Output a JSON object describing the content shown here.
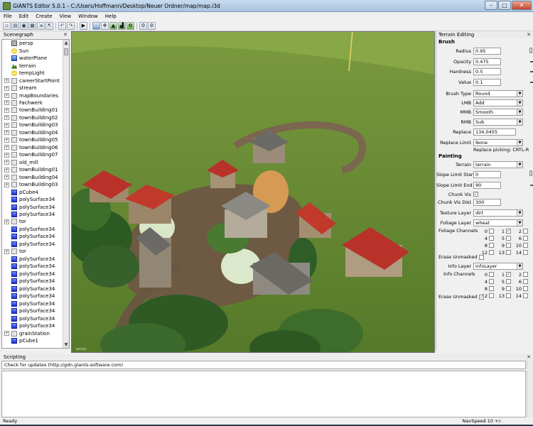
{
  "window": {
    "title": "GIANTS Editor 5.0.1 - C:/Users/Hoffmann/Desktop/Neuer Ordner/map/map.i3d",
    "minimize": "–",
    "maximize": "□",
    "close": "✕"
  },
  "menu": [
    "File",
    "Edit",
    "Create",
    "View",
    "Window",
    "Help"
  ],
  "toolbar": {
    "icons": [
      "new-icon",
      "open-icon",
      "save-icon",
      "save-as-icon",
      "import-icon",
      "export-icon",
      "sep",
      "undo-icon",
      "redo-icon",
      "sep",
      "play-icon",
      "sep",
      "select-tool-icon",
      "move-tool-icon",
      "terrain-sculpt-icon",
      "terrain-paint-icon",
      "foliage-paint-icon",
      "sep",
      "snap-icon",
      "grid-icon"
    ],
    "glyphs": [
      "▫",
      "▤",
      "▣",
      "▦",
      "⇲",
      "⇱",
      "",
      "↶",
      "↷",
      "",
      "▶",
      "",
      "⬚",
      "✥",
      "▲",
      "▟",
      "✿",
      "",
      "⚙",
      "⚙"
    ]
  },
  "scenegraph": {
    "title": "Scenegraph",
    "close": "✕",
    "nodes": [
      {
        "label": "persp",
        "icon": "camera-icon",
        "type": "cam",
        "expander": ""
      },
      {
        "label": "Sun",
        "icon": "light-icon",
        "type": "light",
        "expander": ""
      },
      {
        "label": "waterPlane",
        "icon": "water-icon",
        "type": "water",
        "expander": ""
      },
      {
        "label": "terrain",
        "icon": "terrain-icon",
        "type": "terr",
        "expander": ""
      },
      {
        "label": "tempLight",
        "icon": "light-icon",
        "type": "light",
        "expander": ""
      },
      {
        "label": "careerStartPoint",
        "icon": "transform-icon",
        "type": "folder",
        "expander": "+"
      },
      {
        "label": "stream",
        "icon": "transform-icon",
        "type": "folder",
        "expander": "+"
      },
      {
        "label": "mapBoundaries",
        "icon": "transform-icon",
        "type": "folder",
        "expander": "+"
      },
      {
        "label": "Fachwerk",
        "icon": "transform-icon",
        "type": "folder",
        "expander": "+"
      },
      {
        "label": "townBuilding01",
        "icon": "transform-icon",
        "type": "folder",
        "expander": "+"
      },
      {
        "label": "townBuilding02",
        "icon": "transform-icon",
        "type": "folder",
        "expander": "+"
      },
      {
        "label": "townBuilding03",
        "icon": "transform-icon",
        "type": "folder",
        "expander": "+"
      },
      {
        "label": "townBuilding04",
        "icon": "transform-icon",
        "type": "folder",
        "expander": "+"
      },
      {
        "label": "townBuilding05",
        "icon": "transform-icon",
        "type": "folder",
        "expander": "+"
      },
      {
        "label": "townBuilding06",
        "icon": "transform-icon",
        "type": "folder",
        "expander": "+"
      },
      {
        "label": "townBuilding07",
        "icon": "transform-icon",
        "type": "folder",
        "expander": "+"
      },
      {
        "label": "old_mill",
        "icon": "transform-icon",
        "type": "folder",
        "expander": "+"
      },
      {
        "label": "townBuilding01",
        "icon": "transform-icon",
        "type": "folder",
        "expander": "+"
      },
      {
        "label": "townBuilding04",
        "icon": "transform-icon",
        "type": "folder",
        "expander": "+"
      },
      {
        "label": "townBuilding03",
        "icon": "transform-icon",
        "type": "folder",
        "expander": "+"
      },
      {
        "label": "pCube4",
        "icon": "shape-icon",
        "type": "blue",
        "expander": ""
      },
      {
        "label": "polySurface34",
        "icon": "shape-icon",
        "type": "blue",
        "expander": ""
      },
      {
        "label": "polySurface34",
        "icon": "shape-icon",
        "type": "blue",
        "expander": ""
      },
      {
        "label": "polySurface34",
        "icon": "shape-icon",
        "type": "blue",
        "expander": ""
      },
      {
        "label": "tor",
        "icon": "transform-icon",
        "type": "folder",
        "expander": "+"
      },
      {
        "label": "polySurface34",
        "icon": "shape-icon",
        "type": "blue",
        "expander": ""
      },
      {
        "label": "polySurface34",
        "icon": "shape-icon",
        "type": "blue",
        "expander": ""
      },
      {
        "label": "polySurface34",
        "icon": "shape-icon",
        "type": "blue",
        "expander": ""
      },
      {
        "label": "tor",
        "icon": "transform-icon",
        "type": "folder",
        "expander": "+"
      },
      {
        "label": "polySurface34",
        "icon": "shape-icon",
        "type": "blue",
        "expander": ""
      },
      {
        "label": "polySurface34",
        "icon": "shape-icon",
        "type": "blue",
        "expander": ""
      },
      {
        "label": "polySurface34",
        "icon": "shape-icon",
        "type": "blue",
        "expander": ""
      },
      {
        "label": "polySurface34",
        "icon": "shape-icon",
        "type": "blue",
        "expander": ""
      },
      {
        "label": "polySurface34",
        "icon": "shape-icon",
        "type": "blue",
        "expander": ""
      },
      {
        "label": "polySurface34",
        "icon": "shape-icon",
        "type": "blue",
        "expander": ""
      },
      {
        "label": "polySurface34",
        "icon": "shape-icon",
        "type": "blue",
        "expander": ""
      },
      {
        "label": "polySurface34",
        "icon": "shape-icon",
        "type": "blue",
        "expander": ""
      },
      {
        "label": "polySurface34",
        "icon": "shape-icon",
        "type": "blue",
        "expander": ""
      },
      {
        "label": "polySurface34",
        "icon": "shape-icon",
        "type": "blue",
        "expander": ""
      },
      {
        "label": "grainStation",
        "icon": "transform-icon",
        "type": "folder",
        "expander": "+"
      },
      {
        "label": "pCube1",
        "icon": "shape-icon",
        "type": "blue",
        "expander": ""
      }
    ]
  },
  "viewport": {
    "watermark": "persp"
  },
  "terrain_editing": {
    "title": "Terrain Editing",
    "close": "✕",
    "brush_section": "Brush",
    "radius_label": "Radius",
    "radius": "0.95",
    "opacity_label": "Opacity",
    "opacity": "0.475",
    "hardness_label": "Hardness",
    "hardness": "0.5",
    "value_label": "Value",
    "value": "0.1",
    "brush_type_label": "Brush Type",
    "brush_type": "Round",
    "lmb_label": "LMB",
    "lmb": "Add",
    "mmb_label": "MMB",
    "mmb": "Smooth",
    "rmb_label": "RMB",
    "rmb": "Sub",
    "replace_label": "Replace",
    "replace": "134.0455",
    "replace_limit_label": "Replace Limit",
    "replace_limit": "None",
    "replace_picking": "Replace picking: CRTL-R",
    "painting_section": "Painting",
    "terrain_label": "Terrain",
    "terrain": "terrain",
    "slope_start_label": "Slope Limit Start",
    "slope_start": "0",
    "slope_end_label": "Slope Limit End",
    "slope_end": "90",
    "chunk_vis_label": "Chunk Vis",
    "chunk_vis_check": "✓",
    "chunk_vis_dist_label": "Chunk Vis Dist",
    "chunk_vis_dist": "300",
    "texture_layer_label": "Texture Layer",
    "texture_layer": "dirt",
    "foliage_layer_label": "Foliage Layer",
    "foliage_layer": "wheat",
    "foliage_channels_label": "Foliage Channels",
    "foliage_channels": [
      {
        "n": "0",
        "c": ""
      },
      {
        "n": "1",
        "c": "✓"
      },
      {
        "n": "2",
        "c": ""
      },
      {
        "n": "3",
        "c": ""
      },
      {
        "n": "4",
        "c": ""
      },
      {
        "n": "5",
        "c": ""
      },
      {
        "n": "6",
        "c": ""
      },
      {
        "n": "7",
        "c": ""
      },
      {
        "n": "8",
        "c": ""
      },
      {
        "n": "9",
        "c": ""
      },
      {
        "n": "10",
        "c": ""
      },
      {
        "n": "11",
        "c": ""
      },
      {
        "n": "12",
        "c": ""
      },
      {
        "n": "13",
        "c": ""
      },
      {
        "n": "14",
        "c": ""
      },
      {
        "n": "15",
        "c": ""
      }
    ],
    "erase_unmasked_label": "Erase Unmasked",
    "info_layer_label": "Info Layer",
    "info_layer": "infoLayer",
    "info_channels_label": "Info Channels",
    "info_channels": [
      {
        "n": "0",
        "c": ""
      },
      {
        "n": "1",
        "c": "✓"
      },
      {
        "n": "2",
        "c": ""
      },
      {
        "n": "3",
        "c": ""
      },
      {
        "n": "4",
        "c": ""
      },
      {
        "n": "5",
        "c": ""
      },
      {
        "n": "6",
        "c": ""
      },
      {
        "n": "7",
        "c": ""
      },
      {
        "n": "8",
        "c": ""
      },
      {
        "n": "9",
        "c": ""
      },
      {
        "n": "10",
        "c": ""
      },
      {
        "n": "11",
        "c": ""
      },
      {
        "n": "12",
        "c": ""
      },
      {
        "n": "13",
        "c": ""
      },
      {
        "n": "14",
        "c": ""
      },
      {
        "n": "15",
        "c": ""
      }
    ],
    "erase_unmasked_2_label": "Erase Unmasked",
    "erase_check": "✓"
  },
  "scripting": {
    "title": "Scripting",
    "close": "✕",
    "output": "Check for updates (http://gdn.giants-software.com)"
  },
  "status": {
    "text": "Ready",
    "nav_speed": "NavSpeed 10 +/-"
  },
  "colors": {
    "title_bar": "#b9cfe6",
    "grass": "#6f9a36",
    "roof": "#b8322a",
    "path": "#6e5a42"
  }
}
